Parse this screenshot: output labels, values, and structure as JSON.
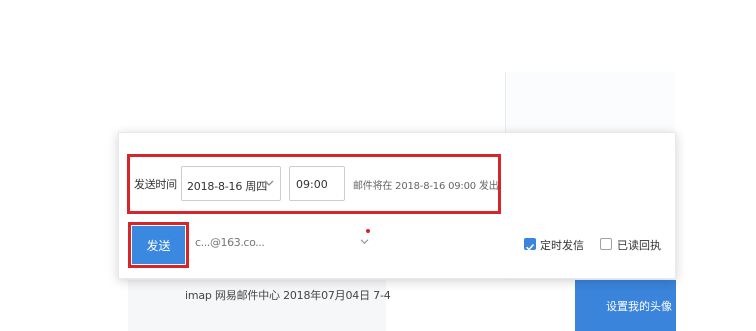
{
  "schedule": {
    "label": "发送时间",
    "date_value": "2018-8-16 周四",
    "time_value": "09:00",
    "hint": "邮件将在 2018-8-16 09:00 发出"
  },
  "compose": {
    "send_label": "发送",
    "sender_account": "c...@163.co...",
    "timed_send_label": "定时发信",
    "timed_send_checked": true,
    "read_receipt_label": "已读回执",
    "read_receipt_checked": false
  },
  "background": {
    "list_item_text": "imap 网易邮件中心 2018年07月04日   7-4",
    "avatar_button_label": "设置我的头像"
  },
  "colors": {
    "highlight": "#d6262b",
    "primary": "#3a88e0"
  },
  "icons": {
    "dropdown": "chevron-down-icon",
    "check": "check-icon"
  }
}
